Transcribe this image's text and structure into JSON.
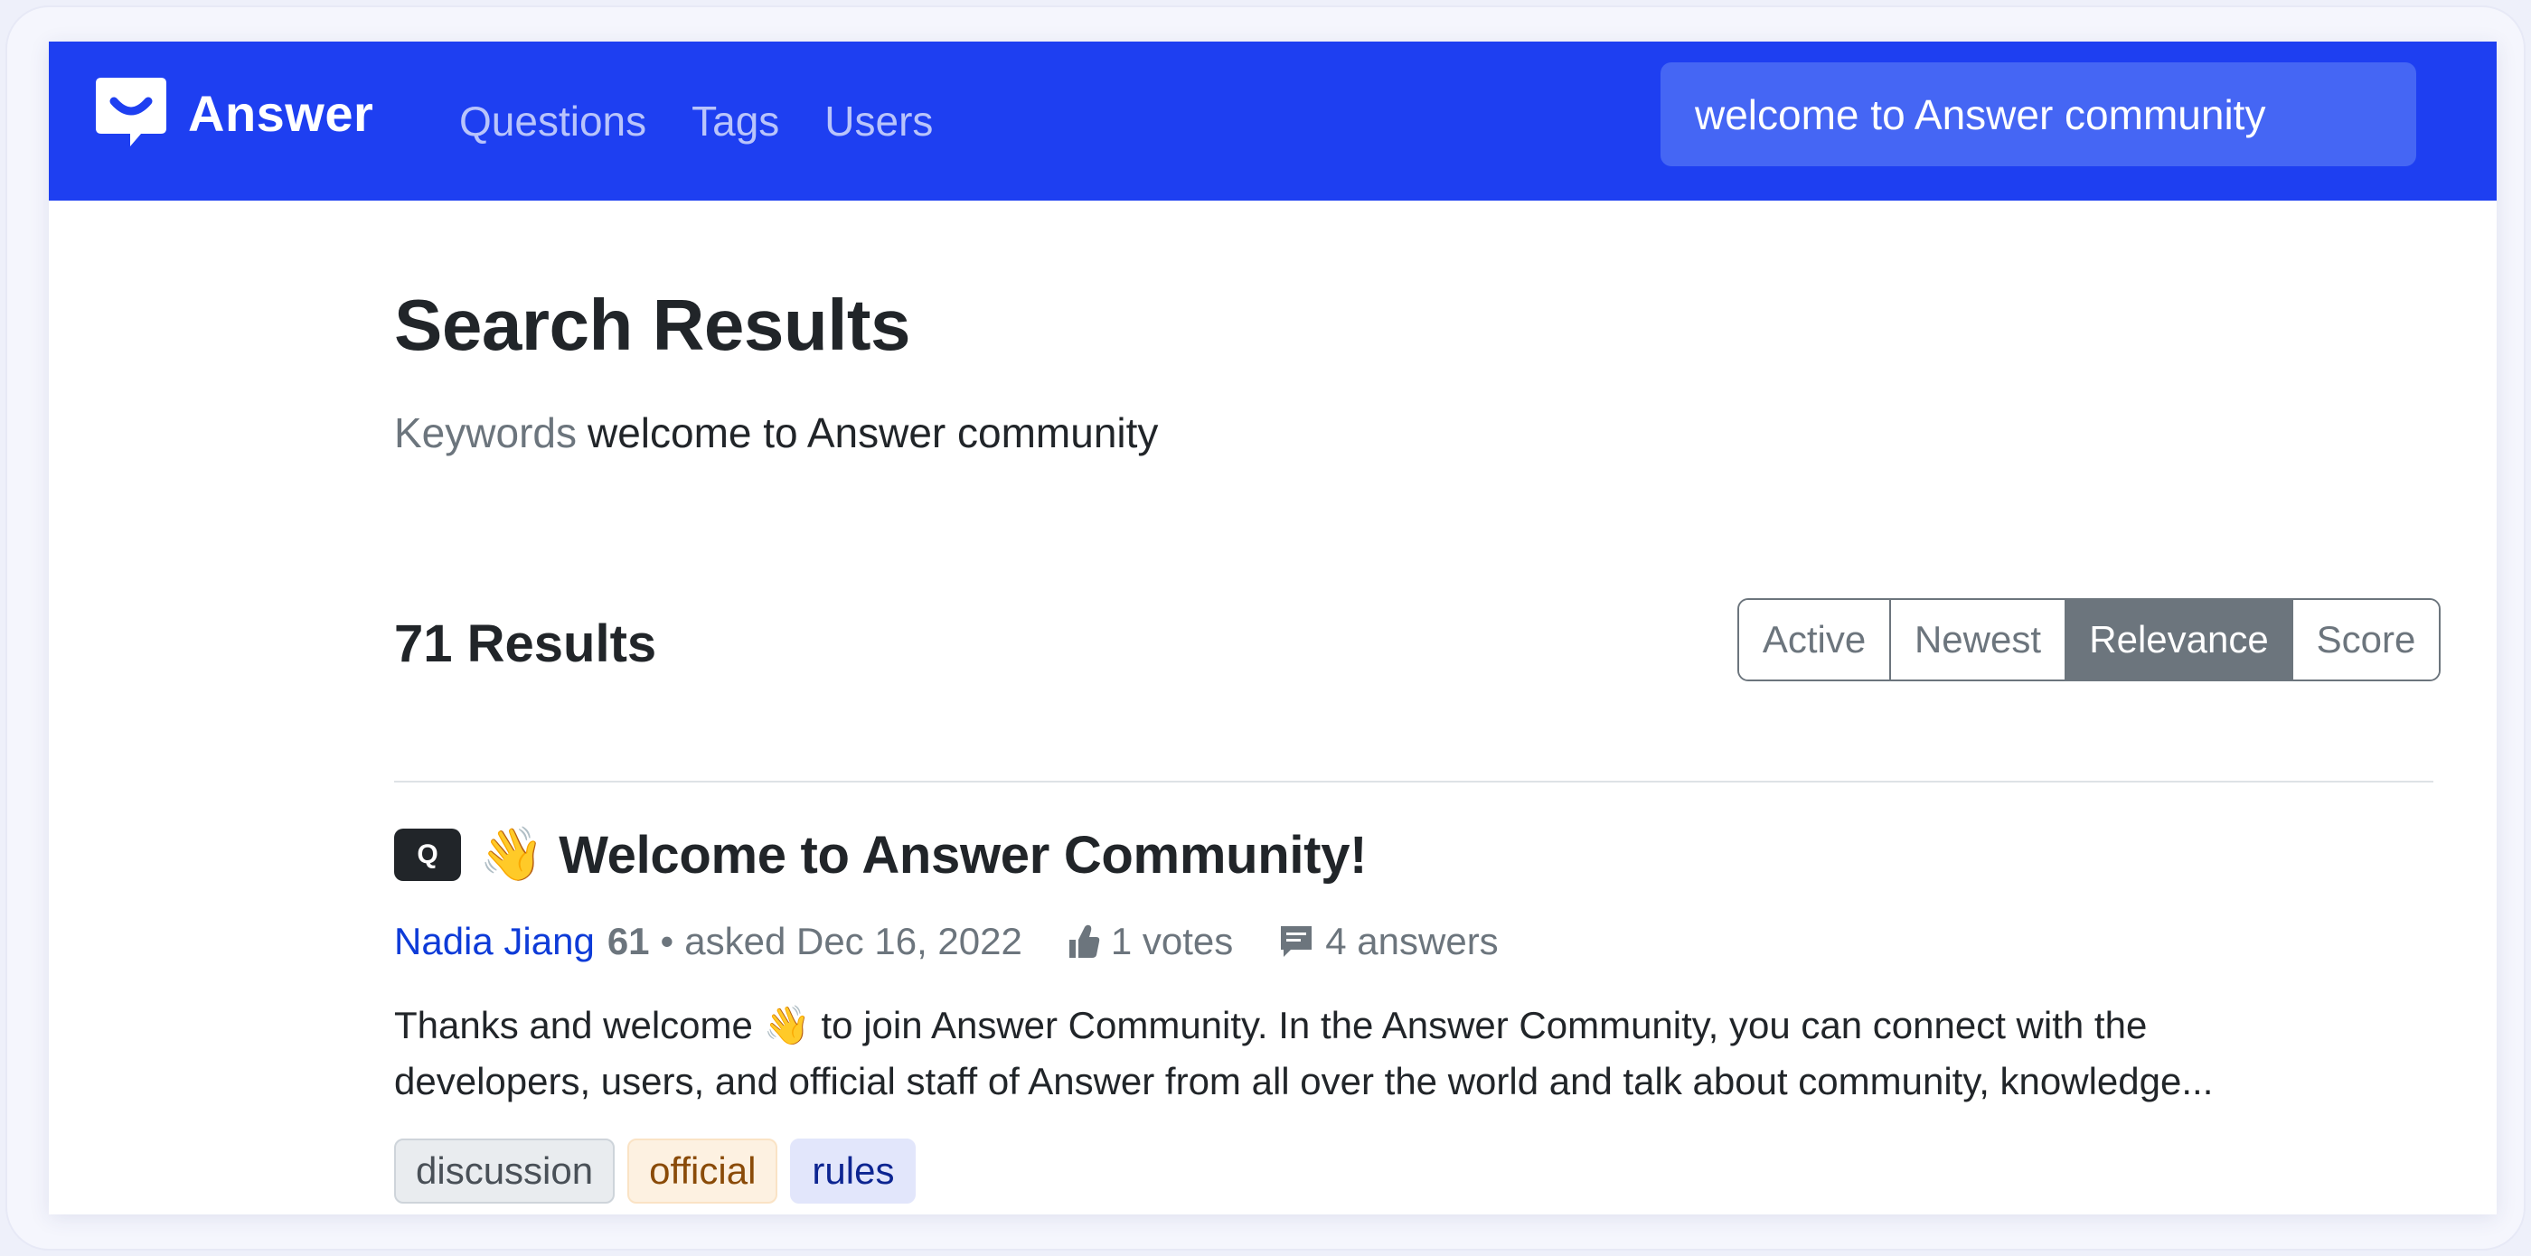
{
  "header": {
    "brand": "Answer",
    "nav": [
      "Questions",
      "Tags",
      "Users"
    ],
    "search_value": "welcome to Answer community",
    "colors": {
      "navbar": "#1e3ff1",
      "search_bg": "#4566f4"
    }
  },
  "main": {
    "title": "Search Results",
    "keywords_label": "Keywords",
    "keywords_value": "welcome to Answer community",
    "results_count": "71 Results",
    "sort_options": [
      "Active",
      "Newest",
      "Relevance",
      "Score"
    ],
    "active_sort": "Relevance"
  },
  "results": [
    {
      "badge": "Q",
      "title_emoji": "👋",
      "title": "Welcome to Answer Community!",
      "author": "Nadia Jiang",
      "reputation": "61",
      "separator": "•",
      "asked": "asked Dec 16, 2022",
      "votes": "1 votes",
      "answers": "4 answers",
      "excerpt_line1_part1": "Thanks and welcome",
      "excerpt_emoji": "👋",
      "excerpt_line1_part2": "to join Answer Community.  In the Answer Community, you can connect with the",
      "excerpt_line2": "developers, users, and official staff of Answer from all over the world and talk about community, knowledge...",
      "tags": [
        {
          "label": "discussion",
          "style": "gray"
        },
        {
          "label": "official",
          "style": "orange"
        },
        {
          "label": "rules",
          "style": "blue"
        }
      ]
    }
  ]
}
